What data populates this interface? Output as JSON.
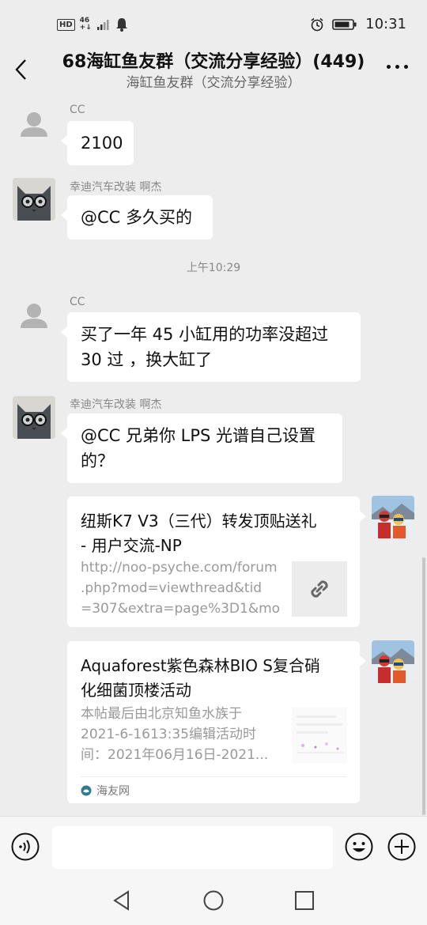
{
  "status_bar": {
    "hd_label": "HD",
    "network_top": "46",
    "network_bottom": "+↓",
    "time": "10:31"
  },
  "header": {
    "title": "68海缸鱼友群（交流分享经验）(449)",
    "subtitle": "海缸鱼友群（交流分享经验）"
  },
  "messages": [
    {
      "sender": "CC",
      "text": "2100",
      "avatar": "default-person-icon"
    },
    {
      "sender": "幸迪汽车改装 啊杰",
      "text": "@CC  多久买的",
      "avatar": "cat-with-glasses"
    }
  ],
  "timestamp": "上午10:29",
  "messages2": [
    {
      "sender": "CC",
      "line1": "买了一年 45 小缸用的功率没超过",
      "line2": "30 过 ，换大缸了",
      "avatar": "default-person-icon"
    },
    {
      "sender": "幸迪汽车改装 啊杰",
      "line1": "@CC  兄弟你 LPS 光谱自己设置",
      "line2": "的？",
      "avatar": "cat-with-glasses"
    }
  ],
  "cards": [
    {
      "title_line1": "纽斯K7 V3（三代）转发顶贴送礼",
      "title_line2": "- 用户交流-NP",
      "desc_line1": "http://noo-psyche.com/forum",
      "desc_line2": ".php?mod=viewthread&tid",
      "desc_line3": "=307&extra=page%3D1&mo...",
      "thumb_icon": "link-icon"
    },
    {
      "title_line1": "Aquaforest紫色森林BIO S复合硝",
      "title_line2": "化细菌顶楼活动",
      "desc_line1": "本帖最后由北京知鱼水族于",
      "desc_line2": "2021-6-1613:35编辑活动时",
      "desc_line3": "间：2021年06月16日-2021...",
      "source": "海友网"
    }
  ],
  "colors": {
    "background": "#ededed",
    "bubble": "#ffffff",
    "meta_text": "#888888"
  }
}
